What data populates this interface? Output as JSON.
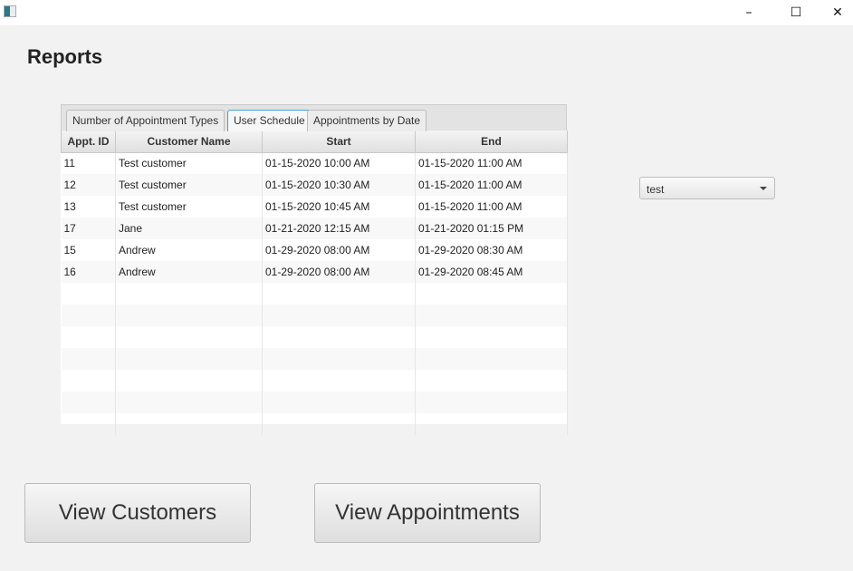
{
  "window": {
    "minimize": "–",
    "maximize": "☐",
    "close": "✕"
  },
  "title": "Reports",
  "tabs": [
    {
      "label": "Number of Appointment Types"
    },
    {
      "label": "User Schedule"
    },
    {
      "label": "Appointments by Date"
    }
  ],
  "table": {
    "columns": [
      "Appt. ID",
      "Customer Name",
      "Start",
      "End"
    ],
    "rows": [
      [
        "11",
        "Test customer",
        "01-15-2020 10:00 AM",
        "01-15-2020 11:00 AM"
      ],
      [
        "12",
        "Test customer",
        "01-15-2020 10:30 AM",
        "01-15-2020 11:00 AM"
      ],
      [
        "13",
        "Test customer",
        "01-15-2020 10:45 AM",
        "01-15-2020 11:00 AM"
      ],
      [
        "17",
        "Jane",
        "01-21-2020 12:15 AM",
        "01-21-2020 01:15 PM"
      ],
      [
        "15",
        "Andrew",
        "01-29-2020 08:00 AM",
        "01-29-2020 08:30 AM"
      ],
      [
        "16",
        "Andrew",
        "01-29-2020 08:00 AM",
        "01-29-2020 08:45 AM"
      ]
    ]
  },
  "user_select": {
    "value": "test"
  },
  "buttons": {
    "view_customers": "View Customers",
    "view_appointments": "View Appointments"
  }
}
